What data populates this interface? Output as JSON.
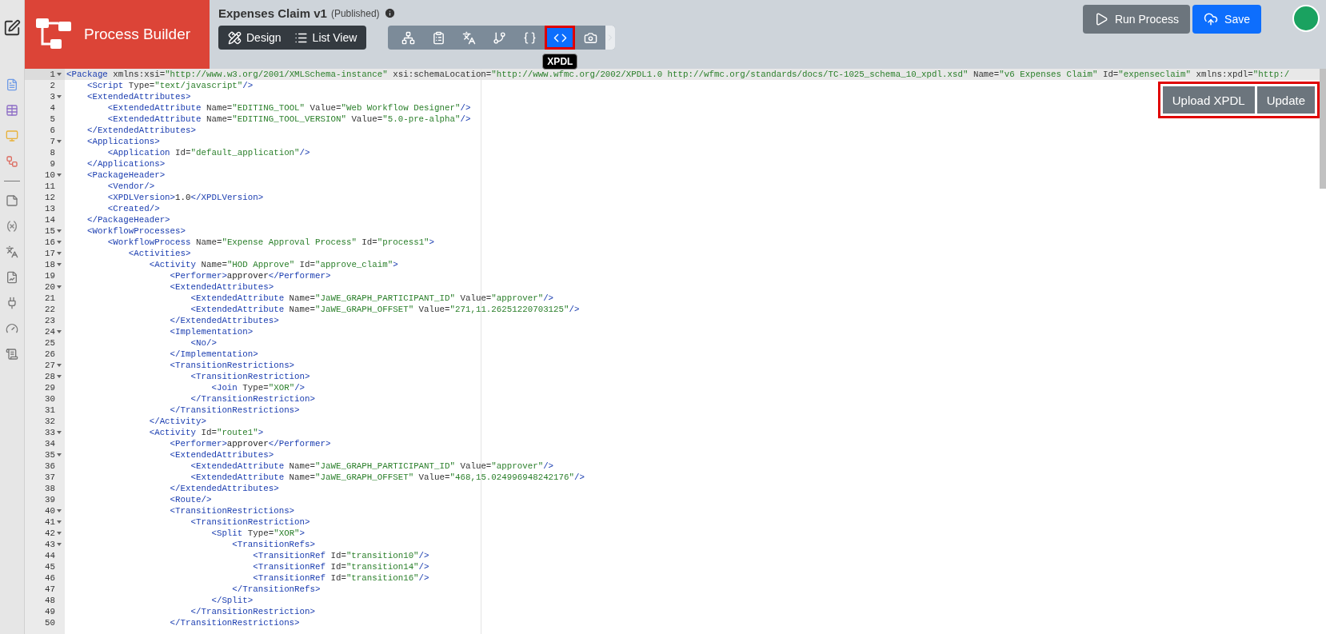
{
  "header": {
    "logo": "Process Builder",
    "title": "Expenses Claim v1",
    "status": "(Published)",
    "views": [
      {
        "kind": "design",
        "label": "Design"
      },
      {
        "kind": "list",
        "label": "List View"
      }
    ],
    "toolbar": {
      "tooltip": "XPDL",
      "items": [
        {
          "kind": "tree",
          "selected": false,
          "highlighted": false
        },
        {
          "kind": "form",
          "selected": false,
          "highlighted": false
        },
        {
          "kind": "translate",
          "selected": false,
          "highlighted": false
        },
        {
          "kind": "branch",
          "selected": false,
          "highlighted": false
        },
        {
          "kind": "braces",
          "selected": false,
          "highlighted": false
        },
        {
          "kind": "code",
          "selected": true,
          "highlighted": true
        },
        {
          "kind": "camera",
          "selected": false,
          "highlighted": false
        }
      ]
    },
    "buttons": [
      {
        "kind": "run",
        "label": "Run Process"
      },
      {
        "kind": "save",
        "label": "Save"
      }
    ]
  },
  "sidebar": {
    "items": [
      {
        "kind": "edit"
      },
      {
        "kind": "document"
      },
      {
        "kind": "table"
      },
      {
        "kind": "monitor"
      },
      {
        "kind": "flow"
      },
      {
        "kind": "divider"
      },
      {
        "kind": "note"
      },
      {
        "kind": "variable"
      },
      {
        "kind": "translate"
      },
      {
        "kind": "report"
      },
      {
        "kind": "plug"
      },
      {
        "kind": "gauge"
      },
      {
        "kind": "scroll"
      }
    ]
  },
  "editor_actions": {
    "highlighted": true,
    "buttons": [
      "Upload XPDL",
      "Update"
    ]
  },
  "editor": {
    "lines": [
      {
        "number": "1",
        "fold": true,
        "active": true,
        "parts": [
          {
            "kind": "tag",
            "text": "<Package"
          },
          {
            "kind": "attr",
            "text": " xmlns:xsi="
          },
          {
            "kind": "value",
            "text": "\"http://www.w3.org/2001/XMLSchema-instance\""
          },
          {
            "kind": "attr",
            "text": " xsi:schemaLocation="
          },
          {
            "kind": "value",
            "text": "\"http://www.wfmc.org/2002/XPDL1.0 http://wfmc.org/standards/docs/TC-1025_schema_10_xpdl.xsd\""
          },
          {
            "kind": "attr",
            "text": " Name="
          },
          {
            "kind": "value",
            "text": "\"v6 Expenses Claim\""
          },
          {
            "kind": "attr",
            "text": " Id="
          },
          {
            "kind": "value",
            "text": "\"expenseclaim\""
          },
          {
            "kind": "attr",
            "text": " xmlns:xpdl="
          },
          {
            "kind": "value",
            "text": "\"http:/"
          }
        ]
      },
      {
        "number": "2",
        "fold": false,
        "active": false,
        "parts": [
          {
            "kind": "tag",
            "text": "    <Script"
          },
          {
            "kind": "attr",
            "text": " Type="
          },
          {
            "kind": "value",
            "text": "\"text/javascript\""
          },
          {
            "kind": "tag",
            "text": "/>"
          }
        ]
      },
      {
        "number": "3",
        "fold": true,
        "active": false,
        "parts": [
          {
            "kind": "tag",
            "text": "    <ExtendedAttributes>"
          }
        ]
      },
      {
        "number": "4",
        "fold": false,
        "active": false,
        "parts": [
          {
            "kind": "tag",
            "text": "        <ExtendedAttribute"
          },
          {
            "kind": "attr",
            "text": " Name="
          },
          {
            "kind": "value",
            "text": "\"EDITING_TOOL\""
          },
          {
            "kind": "attr",
            "text": " Value="
          },
          {
            "kind": "value",
            "text": "\"Web Workflow Designer\""
          },
          {
            "kind": "tag",
            "text": "/>"
          }
        ]
      },
      {
        "number": "5",
        "fold": false,
        "active": false,
        "parts": [
          {
            "kind": "tag",
            "text": "        <ExtendedAttribute"
          },
          {
            "kind": "attr",
            "text": " Name="
          },
          {
            "kind": "value",
            "text": "\"EDITING_TOOL_VERSION\""
          },
          {
            "kind": "attr",
            "text": " Value="
          },
          {
            "kind": "value",
            "text": "\"5.0-pre-alpha\""
          },
          {
            "kind": "tag",
            "text": "/>"
          }
        ]
      },
      {
        "number": "6",
        "fold": false,
        "active": false,
        "parts": [
          {
            "kind": "tag",
            "text": "    </ExtendedAttributes>"
          }
        ]
      },
      {
        "number": "7",
        "fold": true,
        "active": false,
        "parts": [
          {
            "kind": "tag",
            "text": "    <Applications>"
          }
        ]
      },
      {
        "number": "8",
        "fold": false,
        "active": false,
        "parts": [
          {
            "kind": "tag",
            "text": "        <Application"
          },
          {
            "kind": "attr",
            "text": " Id="
          },
          {
            "kind": "value",
            "text": "\"default_application\""
          },
          {
            "kind": "tag",
            "text": "/>"
          }
        ]
      },
      {
        "number": "9",
        "fold": false,
        "active": false,
        "parts": [
          {
            "kind": "tag",
            "text": "    </Applications>"
          }
        ]
      },
      {
        "number": "10",
        "fold": true,
        "active": false,
        "parts": [
          {
            "kind": "tag",
            "text": "    <PackageHeader>"
          }
        ]
      },
      {
        "number": "11",
        "fold": false,
        "active": false,
        "parts": [
          {
            "kind": "tag",
            "text": "        <Vendor/>"
          }
        ]
      },
      {
        "number": "12",
        "fold": false,
        "active": false,
        "parts": [
          {
            "kind": "tag",
            "text": "        <XPDLVersion>"
          },
          {
            "kind": "text",
            "text": "1.0"
          },
          {
            "kind": "tag",
            "text": "</XPDLVersion>"
          }
        ]
      },
      {
        "number": "13",
        "fold": false,
        "active": false,
        "parts": [
          {
            "kind": "tag",
            "text": "        <Created/>"
          }
        ]
      },
      {
        "number": "14",
        "fold": false,
        "active": false,
        "parts": [
          {
            "kind": "tag",
            "text": "    </PackageHeader>"
          }
        ]
      },
      {
        "number": "15",
        "fold": true,
        "active": false,
        "parts": [
          {
            "kind": "tag",
            "text": "    <WorkflowProcesses>"
          }
        ]
      },
      {
        "number": "16",
        "fold": true,
        "active": false,
        "parts": [
          {
            "kind": "tag",
            "text": "        <WorkflowProcess"
          },
          {
            "kind": "attr",
            "text": " Name="
          },
          {
            "kind": "value",
            "text": "\"Expense Approval Process\""
          },
          {
            "kind": "attr",
            "text": " Id="
          },
          {
            "kind": "value",
            "text": "\"process1\""
          },
          {
            "kind": "tag",
            "text": ">"
          }
        ]
      },
      {
        "number": "17",
        "fold": true,
        "active": false,
        "parts": [
          {
            "kind": "tag",
            "text": "            <Activities>"
          }
        ]
      },
      {
        "number": "18",
        "fold": true,
        "active": false,
        "parts": [
          {
            "kind": "tag",
            "text": "                <Activity"
          },
          {
            "kind": "attr",
            "text": " Name="
          },
          {
            "kind": "value",
            "text": "\"HOD Approve\""
          },
          {
            "kind": "attr",
            "text": " Id="
          },
          {
            "kind": "value",
            "text": "\"approve_claim\""
          },
          {
            "kind": "tag",
            "text": ">"
          }
        ]
      },
      {
        "number": "19",
        "fold": false,
        "active": false,
        "parts": [
          {
            "kind": "tag",
            "text": "                    <Performer>"
          },
          {
            "kind": "text",
            "text": "approver"
          },
          {
            "kind": "tag",
            "text": "</Performer>"
          }
        ]
      },
      {
        "number": "20",
        "fold": true,
        "active": false,
        "parts": [
          {
            "kind": "tag",
            "text": "                    <ExtendedAttributes>"
          }
        ]
      },
      {
        "number": "21",
        "fold": false,
        "active": false,
        "parts": [
          {
            "kind": "tag",
            "text": "                        <ExtendedAttribute"
          },
          {
            "kind": "attr",
            "text": " Name="
          },
          {
            "kind": "value",
            "text": "\"JaWE_GRAPH_PARTICIPANT_ID\""
          },
          {
            "kind": "attr",
            "text": " Value="
          },
          {
            "kind": "value",
            "text": "\"approver\""
          },
          {
            "kind": "tag",
            "text": "/>"
          }
        ]
      },
      {
        "number": "22",
        "fold": false,
        "active": false,
        "parts": [
          {
            "kind": "tag",
            "text": "                        <ExtendedAttribute"
          },
          {
            "kind": "attr",
            "text": " Name="
          },
          {
            "kind": "value",
            "text": "\"JaWE_GRAPH_OFFSET\""
          },
          {
            "kind": "attr",
            "text": " Value="
          },
          {
            "kind": "value",
            "text": "\"271,11.26251220703125\""
          },
          {
            "kind": "tag",
            "text": "/>"
          }
        ]
      },
      {
        "number": "23",
        "fold": false,
        "active": false,
        "parts": [
          {
            "kind": "tag",
            "text": "                    </ExtendedAttributes>"
          }
        ]
      },
      {
        "number": "24",
        "fold": true,
        "active": false,
        "parts": [
          {
            "kind": "tag",
            "text": "                    <Implementation>"
          }
        ]
      },
      {
        "number": "25",
        "fold": false,
        "active": false,
        "parts": [
          {
            "kind": "tag",
            "text": "                        <No/>"
          }
        ]
      },
      {
        "number": "26",
        "fold": false,
        "active": false,
        "parts": [
          {
            "kind": "tag",
            "text": "                    </Implementation>"
          }
        ]
      },
      {
        "number": "27",
        "fold": true,
        "active": false,
        "parts": [
          {
            "kind": "tag",
            "text": "                    <TransitionRestrictions>"
          }
        ]
      },
      {
        "number": "28",
        "fold": true,
        "active": false,
        "parts": [
          {
            "kind": "tag",
            "text": "                        <TransitionRestriction>"
          }
        ]
      },
      {
        "number": "29",
        "fold": false,
        "active": false,
        "parts": [
          {
            "kind": "tag",
            "text": "                            <Join"
          },
          {
            "kind": "attr",
            "text": " Type="
          },
          {
            "kind": "value",
            "text": "\"XOR\""
          },
          {
            "kind": "tag",
            "text": "/>"
          }
        ]
      },
      {
        "number": "30",
        "fold": false,
        "active": false,
        "parts": [
          {
            "kind": "tag",
            "text": "                        </TransitionRestriction>"
          }
        ]
      },
      {
        "number": "31",
        "fold": false,
        "active": false,
        "parts": [
          {
            "kind": "tag",
            "text": "                    </TransitionRestrictions>"
          }
        ]
      },
      {
        "number": "32",
        "fold": false,
        "active": false,
        "parts": [
          {
            "kind": "tag",
            "text": "                </Activity>"
          }
        ]
      },
      {
        "number": "33",
        "fold": true,
        "active": false,
        "parts": [
          {
            "kind": "tag",
            "text": "                <Activity"
          },
          {
            "kind": "attr",
            "text": " Id="
          },
          {
            "kind": "value",
            "text": "\"route1\""
          },
          {
            "kind": "tag",
            "text": ">"
          }
        ]
      },
      {
        "number": "34",
        "fold": false,
        "active": false,
        "parts": [
          {
            "kind": "tag",
            "text": "                    <Performer>"
          },
          {
            "kind": "text",
            "text": "approver"
          },
          {
            "kind": "tag",
            "text": "</Performer>"
          }
        ]
      },
      {
        "number": "35",
        "fold": true,
        "active": false,
        "parts": [
          {
            "kind": "tag",
            "text": "                    <ExtendedAttributes>"
          }
        ]
      },
      {
        "number": "36",
        "fold": false,
        "active": false,
        "parts": [
          {
            "kind": "tag",
            "text": "                        <ExtendedAttribute"
          },
          {
            "kind": "attr",
            "text": " Name="
          },
          {
            "kind": "value",
            "text": "\"JaWE_GRAPH_PARTICIPANT_ID\""
          },
          {
            "kind": "attr",
            "text": " Value="
          },
          {
            "kind": "value",
            "text": "\"approver\""
          },
          {
            "kind": "tag",
            "text": "/>"
          }
        ]
      },
      {
        "number": "37",
        "fold": false,
        "active": false,
        "parts": [
          {
            "kind": "tag",
            "text": "                        <ExtendedAttribute"
          },
          {
            "kind": "attr",
            "text": " Name="
          },
          {
            "kind": "value",
            "text": "\"JaWE_GRAPH_OFFSET\""
          },
          {
            "kind": "attr",
            "text": " Value="
          },
          {
            "kind": "value",
            "text": "\"468,15.024996948242176\""
          },
          {
            "kind": "tag",
            "text": "/>"
          }
        ]
      },
      {
        "number": "38",
        "fold": false,
        "active": false,
        "parts": [
          {
            "kind": "tag",
            "text": "                    </ExtendedAttributes>"
          }
        ]
      },
      {
        "number": "39",
        "fold": false,
        "active": false,
        "parts": [
          {
            "kind": "tag",
            "text": "                    <Route/>"
          }
        ]
      },
      {
        "number": "40",
        "fold": true,
        "active": false,
        "parts": [
          {
            "kind": "tag",
            "text": "                    <TransitionRestrictions>"
          }
        ]
      },
      {
        "number": "41",
        "fold": true,
        "active": false,
        "parts": [
          {
            "kind": "tag",
            "text": "                        <TransitionRestriction>"
          }
        ]
      },
      {
        "number": "42",
        "fold": true,
        "active": false,
        "parts": [
          {
            "kind": "tag",
            "text": "                            <Split"
          },
          {
            "kind": "attr",
            "text": " Type="
          },
          {
            "kind": "value",
            "text": "\"XOR\""
          },
          {
            "kind": "tag",
            "text": ">"
          }
        ]
      },
      {
        "number": "43",
        "fold": true,
        "active": false,
        "parts": [
          {
            "kind": "tag",
            "text": "                                <TransitionRefs>"
          }
        ]
      },
      {
        "number": "44",
        "fold": false,
        "active": false,
        "parts": [
          {
            "kind": "tag",
            "text": "                                    <TransitionRef"
          },
          {
            "kind": "attr",
            "text": " Id="
          },
          {
            "kind": "value",
            "text": "\"transition10\""
          },
          {
            "kind": "tag",
            "text": "/>"
          }
        ]
      },
      {
        "number": "45",
        "fold": false,
        "active": false,
        "parts": [
          {
            "kind": "tag",
            "text": "                                    <TransitionRef"
          },
          {
            "kind": "attr",
            "text": " Id="
          },
          {
            "kind": "value",
            "text": "\"transition14\""
          },
          {
            "kind": "tag",
            "text": "/>"
          }
        ]
      },
      {
        "number": "46",
        "fold": false,
        "active": false,
        "parts": [
          {
            "kind": "tag",
            "text": "                                    <TransitionRef"
          },
          {
            "kind": "attr",
            "text": " Id="
          },
          {
            "kind": "value",
            "text": "\"transition16\""
          },
          {
            "kind": "tag",
            "text": "/>"
          }
        ]
      },
      {
        "number": "47",
        "fold": false,
        "active": false,
        "parts": [
          {
            "kind": "tag",
            "text": "                                </TransitionRefs>"
          }
        ]
      },
      {
        "number": "48",
        "fold": false,
        "active": false,
        "parts": [
          {
            "kind": "tag",
            "text": "                            </Split>"
          }
        ]
      },
      {
        "number": "49",
        "fold": false,
        "active": false,
        "parts": [
          {
            "kind": "tag",
            "text": "                        </TransitionRestriction>"
          }
        ]
      },
      {
        "number": "50",
        "fold": false,
        "active": false,
        "parts": [
          {
            "kind": "tag",
            "text": "                    </TransitionRestrictions>"
          }
        ]
      }
    ]
  }
}
